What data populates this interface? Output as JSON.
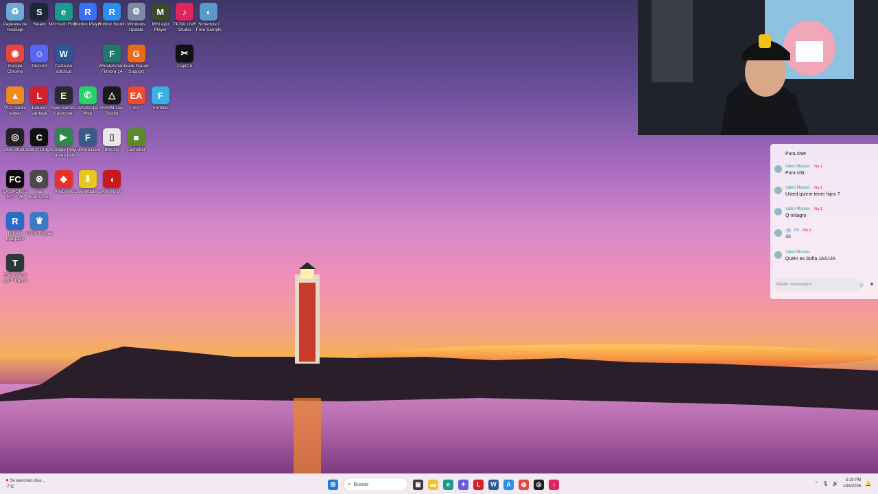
{
  "desktop": {
    "icons": [
      {
        "label": "Papelera de reciclaje",
        "icon": "recycle-bin-icon",
        "color": "#6aa9d8",
        "glyph": "♻"
      },
      {
        "label": "Steam",
        "icon": "steam-icon",
        "color": "#1b2838",
        "glyph": "S"
      },
      {
        "label": "Microsoft Edge",
        "icon": "edge-icon",
        "color": "#1a9b8f",
        "glyph": "e"
      },
      {
        "label": "Roblox Player",
        "icon": "roblox-icon",
        "color": "#3a6ff0",
        "glyph": "R"
      },
      {
        "label": "Roblox Studio",
        "icon": "roblox-studio-icon",
        "color": "#2a8df0",
        "glyph": "R"
      },
      {
        "label": "Windows Update",
        "icon": "windows-update-icon",
        "color": "#7d8aa5",
        "glyph": "⚙"
      },
      {
        "label": "MSI App Player",
        "icon": "msi-app-player-icon",
        "color": "#3a4a2a",
        "glyph": "M"
      },
      {
        "label": "TikTok LIVE Studio",
        "icon": "tiktok-live-icon",
        "color": "#e0245e",
        "glyph": "♪"
      },
      {
        "label": "Schedule I Free Sample",
        "icon": "schedule-i-icon",
        "color": "#5a9ac8",
        "glyph": "◐"
      },
      {
        "label": "Google Chrome",
        "icon": "chrome-icon",
        "color": "#e8453c",
        "glyph": "◉"
      },
      {
        "label": "Discord",
        "icon": "discord-icon",
        "color": "#5865f2",
        "glyph": "☺"
      },
      {
        "label": "Carta de solicitud",
        "icon": "word-doc-icon",
        "color": "#2b5797",
        "glyph": "W"
      },
      {
        "label": "Wondershare Filmora 14",
        "icon": "filmora-icon",
        "color": "#1e7a6a",
        "glyph": "F"
      },
      {
        "label": "Geek Squad Support",
        "icon": "geek-squad-icon",
        "color": "#e86a1a",
        "glyph": "G"
      },
      {
        "label": "CapCut",
        "icon": "capcut-icon",
        "color": "#111111",
        "glyph": "✂"
      },
      {
        "label": "VLC media player",
        "icon": "vlc-icon",
        "color": "#f08a1a",
        "glyph": "▲"
      },
      {
        "label": "Lenovo Vantage",
        "icon": "lenovo-vantage-icon",
        "color": "#d81e2a",
        "glyph": "L"
      },
      {
        "label": "Epic Games Launcher",
        "icon": "epic-games-icon",
        "color": "#2a2a2a",
        "glyph": "E"
      },
      {
        "label": "WhatsApp Web",
        "icon": "whatsapp-icon",
        "color": "#25d366",
        "glyph": "✆"
      },
      {
        "label": "PRISM Live Studio",
        "icon": "prism-icon",
        "color": "#1a1a1a",
        "glyph": "△"
      },
      {
        "label": "EA",
        "icon": "ea-icon",
        "color": "#f04a2a",
        "glyph": "EA"
      },
      {
        "label": "Fortnite",
        "icon": "fortnite-icon",
        "color": "#3ab0e8",
        "glyph": "F"
      },
      {
        "label": "OBS Studio",
        "icon": "obs-icon",
        "color": "#222222",
        "glyph": "◎"
      },
      {
        "label": "Call of Duty®",
        "icon": "call-of-duty-icon",
        "color": "#101010",
        "glyph": "C"
      },
      {
        "label": "Google Play Games beta",
        "icon": "google-play-games-icon",
        "color": "#2a8a4a",
        "glyph": "▶"
      },
      {
        "label": "Filmora Beta",
        "icon": "filmora-beta-icon",
        "color": "#3a5a8a",
        "glyph": "F"
      },
      {
        "label": "Bhs.zip",
        "icon": "zip-file-icon",
        "color": "#e8e8e8",
        "glyph": "▯"
      },
      {
        "label": "Launcher",
        "icon": "minecraft-launcher-icon",
        "color": "#5a8a2a",
        "glyph": "■"
      },
      {
        "label": "EA SPORTS FC™ 26",
        "icon": "ea-fc-icon",
        "color": "#0a0a0a",
        "glyph": "FC"
      },
      {
        "label": "Más información",
        "icon": "more-info-icon",
        "color": "#4a4a4a",
        "glyph": "⊗"
      },
      {
        "label": "AnyDesk",
        "icon": "anydesk-icon",
        "color": "#e8302a",
        "glyph": "◆"
      },
      {
        "label": "iDownloader 2",
        "icon": "idownloader-icon",
        "color": "#e8c81a",
        "glyph": "⬇"
      },
      {
        "label": "Among Us",
        "icon": "among-us-icon",
        "color": "#c81a1a",
        "glyph": "◖"
      },
      {
        "label": "Rocket League®",
        "icon": "rocket-league-icon",
        "color": "#2a6ac8",
        "glyph": "R"
      },
      {
        "label": "Clash Royale",
        "icon": "clash-royale-icon",
        "color": "#3a7ac8",
        "glyph": "♛"
      },
      {
        "label": "The Last of Us™ Part II",
        "icon": "last-of-us-icon",
        "color": "#2a3a3a",
        "glyph": "T"
      }
    ]
  },
  "chat": {
    "top_message": "Pura shet",
    "messages": [
      {
        "user": "Valeri Mateus",
        "badge": "No.1",
        "level": "",
        "text": "Pura shit"
      },
      {
        "user": "Valeri Mateus",
        "badge": "No.1",
        "level": "",
        "text": "Usted quiere tener hijos ?"
      },
      {
        "user": "Valeri Mateus",
        "badge": "No.1",
        "level": "",
        "text": "Q milagro"
      },
      {
        "user": "AS",
        "badge": "No.2",
        "level": "1",
        "text": "33"
      },
      {
        "user": "Valeri Mateus",
        "badge": "",
        "level": "",
        "text": "Quién es Sofía JAAJJA"
      }
    ],
    "comment_placeholder": "Añadir comentario"
  },
  "taskbar": {
    "weather_line1": "Se avecinan días...",
    "weather_line2": "-7°C",
    "search_placeholder": "Buscar",
    "time": "5:19 PM",
    "date": "1/16/2026"
  }
}
